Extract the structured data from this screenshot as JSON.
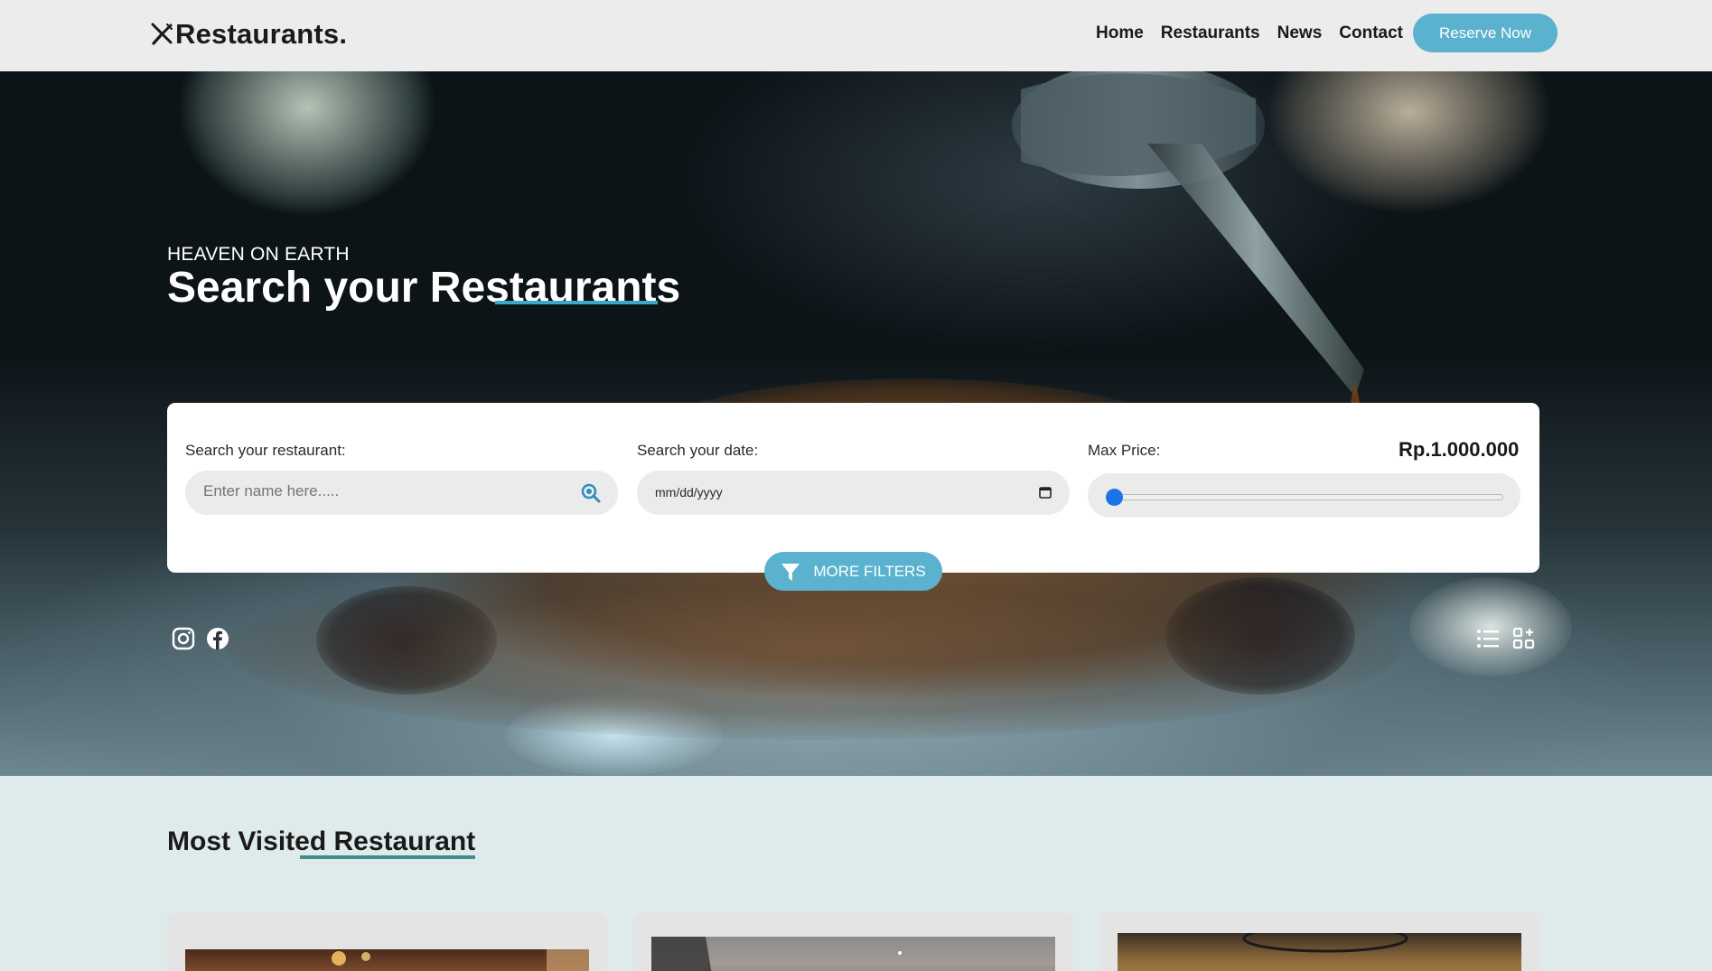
{
  "header": {
    "logo_text": "Restaurants.",
    "nav": [
      "Home",
      "Restaurants",
      "News",
      "Contact"
    ],
    "reserve_label": "Reserve Now"
  },
  "hero": {
    "eyebrow": "HEAVEN ON EARTH",
    "title": "Search your Restaurants"
  },
  "search": {
    "restaurant_label": "Search your restaurant:",
    "restaurant_placeholder": "Enter name here.....",
    "date_label": "Search your date:",
    "date_placeholder": "mm/dd/yyyy",
    "price_label": "Max Price:",
    "price_value": "Rp.1.000.000",
    "price_slider_fraction": 0,
    "more_filters_label": "MORE FILTERS"
  },
  "social": {
    "icons": [
      "instagram-icon",
      "facebook-icon"
    ]
  },
  "view_toggle": {
    "icons": [
      "list-view-icon",
      "grid-view-icon"
    ]
  },
  "most_visited": {
    "title": "Most Visited Restaurant"
  },
  "colors": {
    "accent": "#5ab2cf",
    "underline_hero": "#3aa8c9",
    "underline_section": "#3f8d8e",
    "slider": "#1a73e8"
  }
}
